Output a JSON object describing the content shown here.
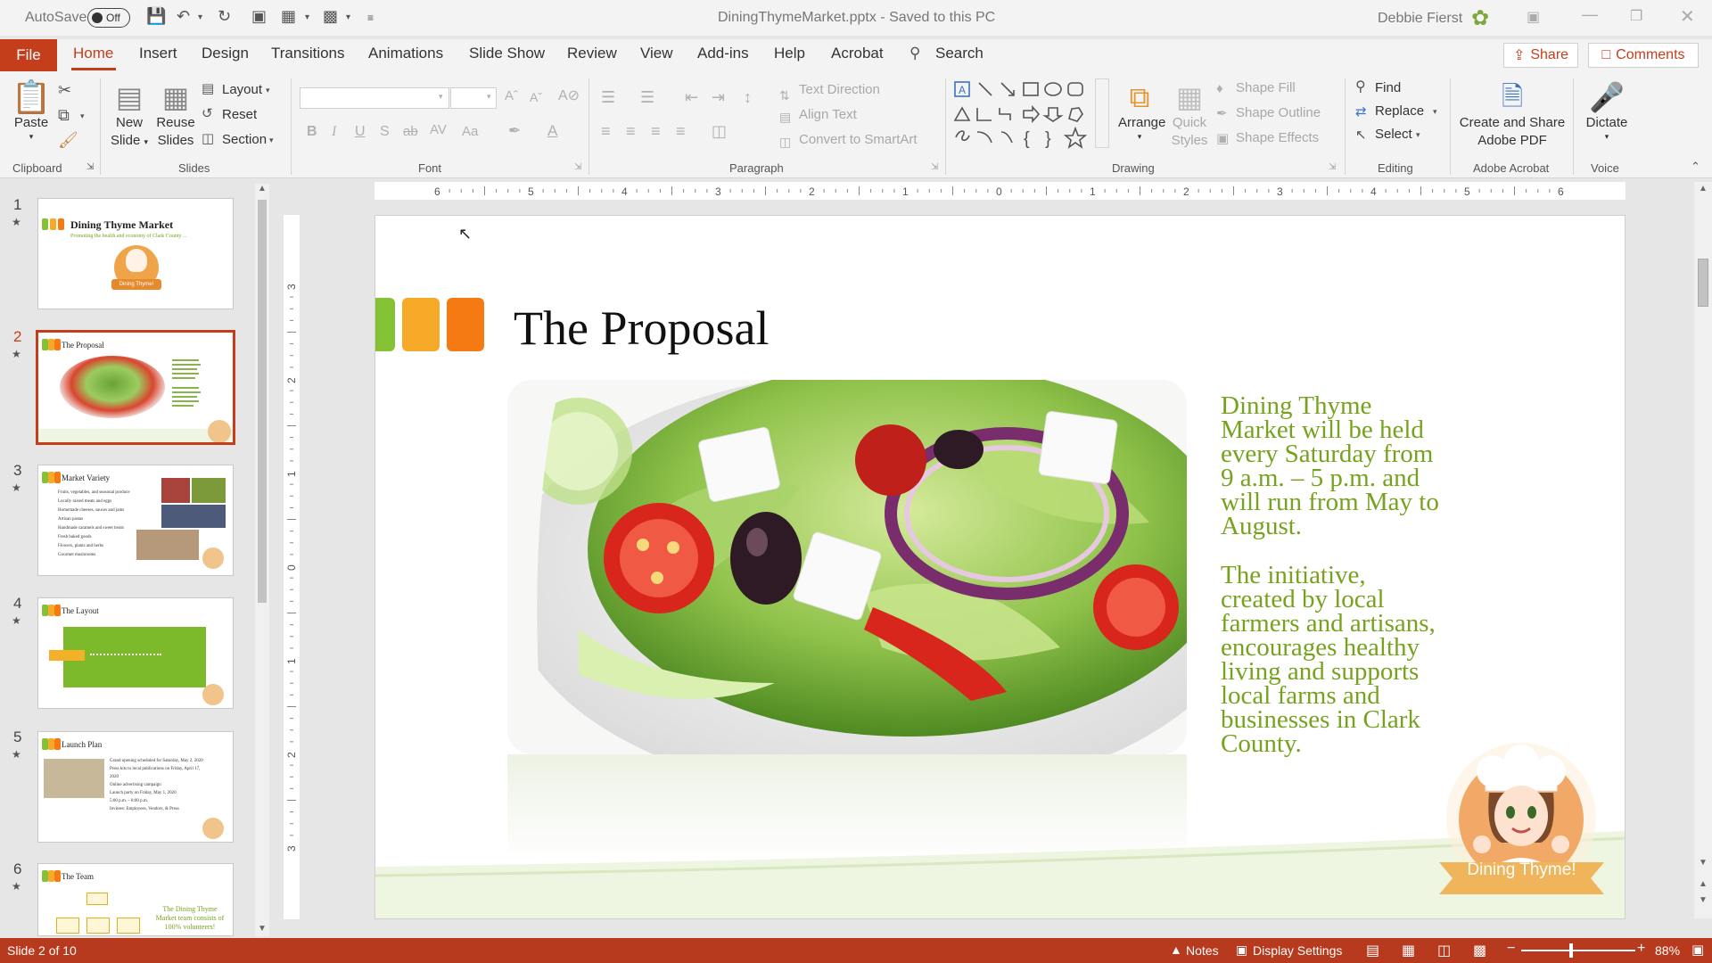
{
  "titlebar": {
    "autosave_label": "AutoSave",
    "autosave_state": "Off",
    "doc_title": "DiningThymeMarket.pptx  -  Saved to this PC",
    "user": "Debbie Fierst"
  },
  "tabs": {
    "file": "File",
    "items": [
      "Home",
      "Insert",
      "Design",
      "Transitions",
      "Animations",
      "Slide Show",
      "Review",
      "View",
      "Add-ins",
      "Help",
      "Acrobat"
    ],
    "search": "Search",
    "share": "Share",
    "comments": "Comments"
  },
  "ribbon": {
    "clipboard": {
      "label": "Clipboard",
      "paste": "Paste"
    },
    "slides": {
      "label": "Slides",
      "new_slide_1": "New",
      "new_slide_2": "Slide",
      "reuse_1": "Reuse",
      "reuse_2": "Slides",
      "layout": "Layout",
      "reset": "Reset",
      "section": "Section"
    },
    "font": {
      "label": "Font"
    },
    "paragraph": {
      "label": "Paragraph",
      "text_direction": "Text Direction",
      "align_text": "Align Text",
      "convert": "Convert to SmartArt"
    },
    "drawing": {
      "label": "Drawing",
      "arrange": "Arrange",
      "quick_1": "Quick",
      "quick_2": "Styles",
      "shape_fill": "Shape Fill",
      "shape_outline": "Shape Outline",
      "shape_effects": "Shape Effects"
    },
    "editing": {
      "label": "Editing",
      "find": "Find",
      "replace": "Replace",
      "select": "Select"
    },
    "acrobat": {
      "label": "Adobe Acrobat",
      "create_1": "Create and Share",
      "create_2": "Adobe PDF"
    },
    "voice": {
      "label": "Voice",
      "dictate": "Dictate"
    }
  },
  "thumbnails": [
    {
      "num": "1",
      "title": "Dining Thyme Market",
      "subtitle": "Promoting the health and economy of Clark County ...",
      "badge": "Dining Thyme!"
    },
    {
      "num": "2",
      "title": "The Proposal"
    },
    {
      "num": "3",
      "title": "Market Variety",
      "bullets": [
        "Fruits, vegetables, and seasonal produce",
        "Locally raised meats and eggs",
        "Homemade cheeses, sauces and jams",
        "Artisan pastas",
        "Handmade caramels and sweet treats",
        "Fresh baked goods",
        "Flowers, plants and herbs",
        "Gourmet mushrooms"
      ]
    },
    {
      "num": "4",
      "title": "The Layout"
    },
    {
      "num": "5",
      "title": "Launch Plan",
      "bullets": [
        "Grand opening scheduled for Saturday, May 2, 2020",
        "Press kits to local publications on Friday, April 17, 2020",
        "Online advertising campaign",
        "Launch party on Friday, May 1, 2020",
        "5:00 p.m. – 8:00 p.m.",
        "Invitees: Employees, Vendors, & Press"
      ]
    },
    {
      "num": "6",
      "title": "The Team",
      "side": "The Dining Thyme Market team consists of 100% volunteers!"
    }
  ],
  "ruler": {
    "h_labels": [
      "6",
      "5",
      "4",
      "3",
      "2",
      "1",
      "0",
      "1",
      "2",
      "3",
      "4",
      "5",
      "6"
    ],
    "v_labels": [
      "3",
      "2",
      "1",
      "0",
      "1",
      "2",
      "3"
    ]
  },
  "slide": {
    "title": "The Proposal",
    "para1": [
      "Dining Thyme",
      "Market will be held",
      "every Saturday from",
      "9 a.m. – 5 p.m. and",
      "will run from May to",
      "August."
    ],
    "para2": [
      "The initiative,",
      "created by local",
      "farmers and artisans,",
      "encourages healthy",
      "living and supports",
      "local farms and",
      "businesses in Clark",
      "County."
    ],
    "badge": "Dining Thyme!"
  },
  "status": {
    "slide_count": "Slide 2 of 10",
    "notes": "Notes",
    "display": "Display Settings",
    "zoom": "88%"
  },
  "colors": {
    "accent": "#c43e1c",
    "green": "#76a21e",
    "orange": "#f57a14",
    "amber": "#f7a928",
    "lime": "#84c234"
  }
}
